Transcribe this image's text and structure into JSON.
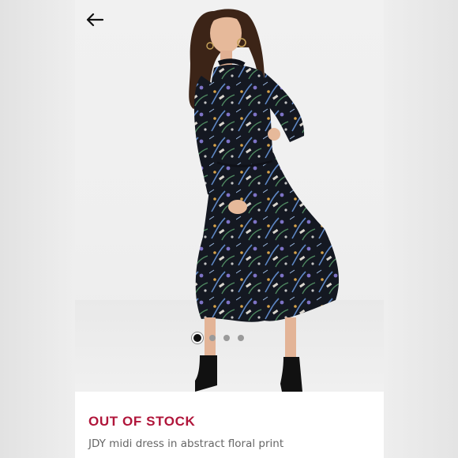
{
  "product": {
    "status_label": "OUT OF STOCK",
    "title": "JDY midi dress in abstract floral print"
  },
  "gallery": {
    "image_count": 4,
    "active_index": 0
  },
  "icons": {
    "back": "arrow-left-icon"
  },
  "colors": {
    "status": "#b0153a",
    "background": "#ffffff",
    "dot_active": "#111111",
    "dot_inactive": "#9a9a9a"
  }
}
